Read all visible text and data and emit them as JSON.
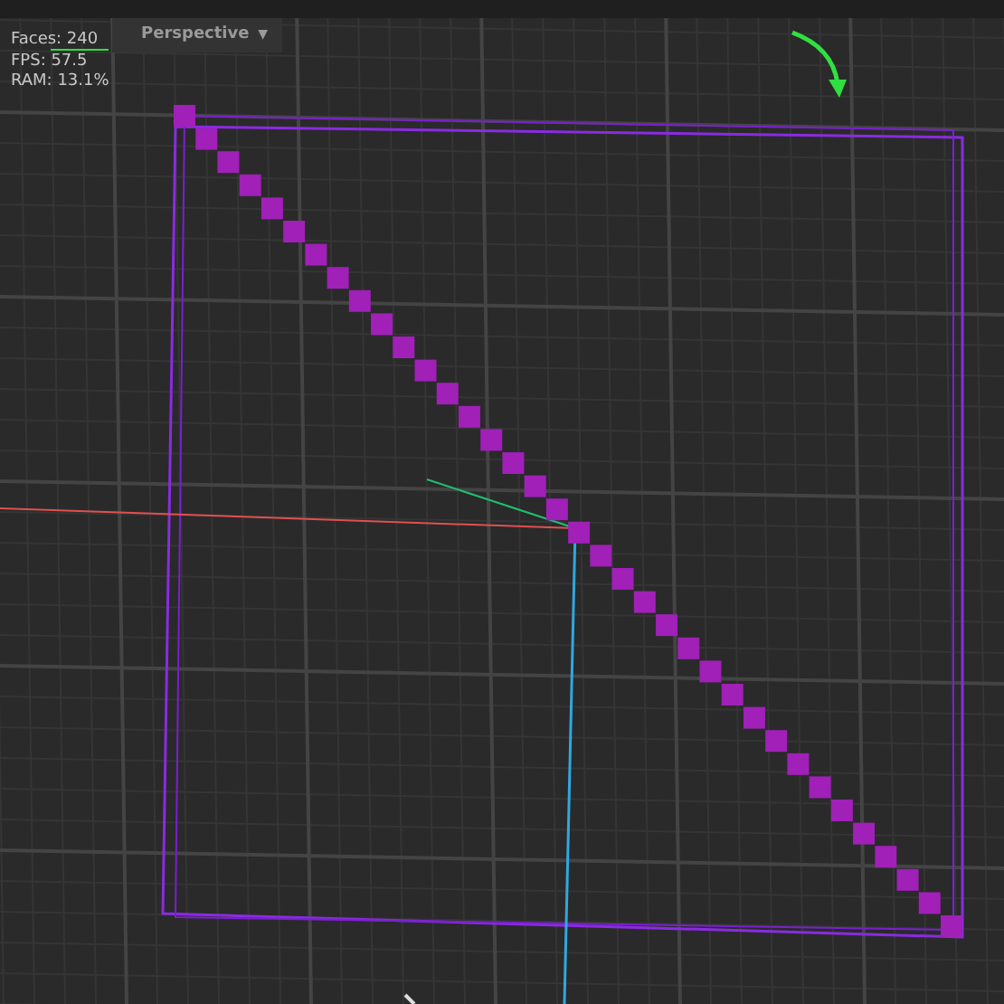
{
  "stats": [
    "Faces: 240",
    "FPS: 57.5",
    "RAM: 13.1%"
  ],
  "view_menu": {
    "label": "Perspective",
    "caret": "▼"
  }
}
